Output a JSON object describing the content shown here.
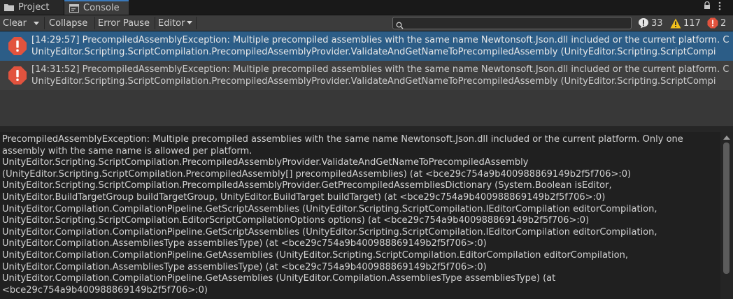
{
  "tabs": [
    {
      "label": "Project",
      "icon": "folder-icon"
    },
    {
      "label": "Console",
      "icon": "console-icon"
    }
  ],
  "toolbar": {
    "clear_label": "Clear",
    "collapse_label": "Collapse",
    "error_pause_label": "Error Pause",
    "editor_label": "Editor",
    "search_placeholder": "",
    "search_value": ""
  },
  "counts": {
    "info": "33",
    "warnings": "117",
    "errors": "2"
  },
  "entries": [
    {
      "line1": "[14:29:57] PrecompiledAssemblyException: Multiple precompiled assemblies with the same name Newtonsoft.Json.dll included or the current platform. C",
      "line2": "UnityEditor.Scripting.ScriptCompilation.PrecompiledAssemblyProvider.ValidateAndGetNameToPrecompiledAssembly (UnityEditor.Scripting.ScriptCompi",
      "selected": true
    },
    {
      "line1": "[14:31:52] PrecompiledAssemblyException: Multiple precompiled assemblies with the same name Newtonsoft.Json.dll included or the current platform. C",
      "line2": "UnityEditor.Scripting.ScriptCompilation.PrecompiledAssemblyProvider.ValidateAndGetNameToPrecompiledAssembly (UnityEditor.Scripting.ScriptCompi",
      "selected": false
    }
  ],
  "detail_lines": [
    "PrecompiledAssemblyException: Multiple precompiled assemblies with the same name Newtonsoft.Json.dll included or the current platform. Only one",
    "assembly with the same name is allowed per platform.",
    "UnityEditor.Scripting.ScriptCompilation.PrecompiledAssemblyProvider.ValidateAndGetNameToPrecompiledAssembly",
    "(UnityEditor.Scripting.ScriptCompilation.PrecompiledAssembly[] precompiledAssemblies) (at <bce29c754a9b400988869149b2f5f706>:0)",
    "UnityEditor.Scripting.ScriptCompilation.PrecompiledAssemblyProvider.GetPrecompiledAssembliesDictionary (System.Boolean isEditor,",
    "UnityEditor.BuildTargetGroup buildTargetGroup, UnityEditor.BuildTarget buildTarget) (at <bce29c754a9b400988869149b2f5f706>:0)",
    "UnityEditor.Compilation.CompilationPipeline.GetScriptAssemblies (UnityEditor.Scripting.ScriptCompilation.IEditorCompilation editorCompilation,",
    "UnityEditor.Scripting.ScriptCompilation.EditorScriptCompilationOptions options) (at <bce29c754a9b400988869149b2f5f706>:0)",
    "UnityEditor.Compilation.CompilationPipeline.GetScriptAssemblies (UnityEditor.Scripting.ScriptCompilation.IEditorCompilation editorCompilation,",
    "UnityEditor.Compilation.AssembliesType assembliesType) (at <bce29c754a9b400988869149b2f5f706>:0)",
    "UnityEditor.Compilation.CompilationPipeline.GetAssemblies (UnityEditor.Scripting.ScriptCompilation.EditorCompilation editorCompilation,",
    "UnityEditor.Compilation.AssembliesType assembliesType) (at <bce29c754a9b400988869149b2f5f706>:0)",
    "UnityEditor.Compilation.CompilationPipeline.GetAssemblies (UnityEditor.Compilation.AssembliesType assembliesType) (at",
    "<bce29c754a9b400988869149b2f5f706>:0)"
  ],
  "colors": {
    "selected_row": "#2c5d87",
    "error_red": "#e2533e",
    "warning_yellow": "#f2c11c",
    "info_white": "#e6e6e6"
  }
}
